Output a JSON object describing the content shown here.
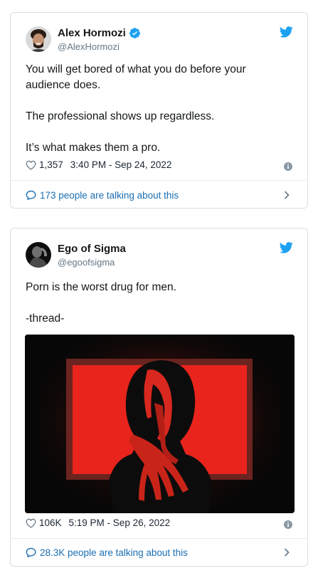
{
  "tweets": [
    {
      "author": "Alex Hormozi",
      "handle": "@AlexHormozi",
      "verified": true,
      "text": "You will get bored of what you do before your\naudience does.\n\nThe professional shows up regardless.\n\nIt’s what makes them a pro.",
      "likes": "1,357",
      "timestamp": "3:40 PM - Sep 24, 2022",
      "talking": "173 people are talking about this"
    },
    {
      "author": "Ego of Sigma",
      "handle": "@egoofsigma",
      "verified": false,
      "text": "Porn is the worst drug for men.\n\n-thread-",
      "likes": "106K",
      "timestamp": "5:19 PM - Sep 26, 2022",
      "talking": "28.3K people are talking about this"
    }
  ],
  "icons": {
    "brand": "twitter-bird-icon",
    "verified": "verified-badge-icon",
    "like": "heart-icon",
    "info": "info-icon",
    "reply": "speech-bubble-icon",
    "more": "chevron-right-icon"
  },
  "colors": {
    "twitter_blue": "#1da1f2",
    "link_blue": "#1b6fb3",
    "border": "#d9dfe4",
    "image_red": "#e8241c"
  }
}
